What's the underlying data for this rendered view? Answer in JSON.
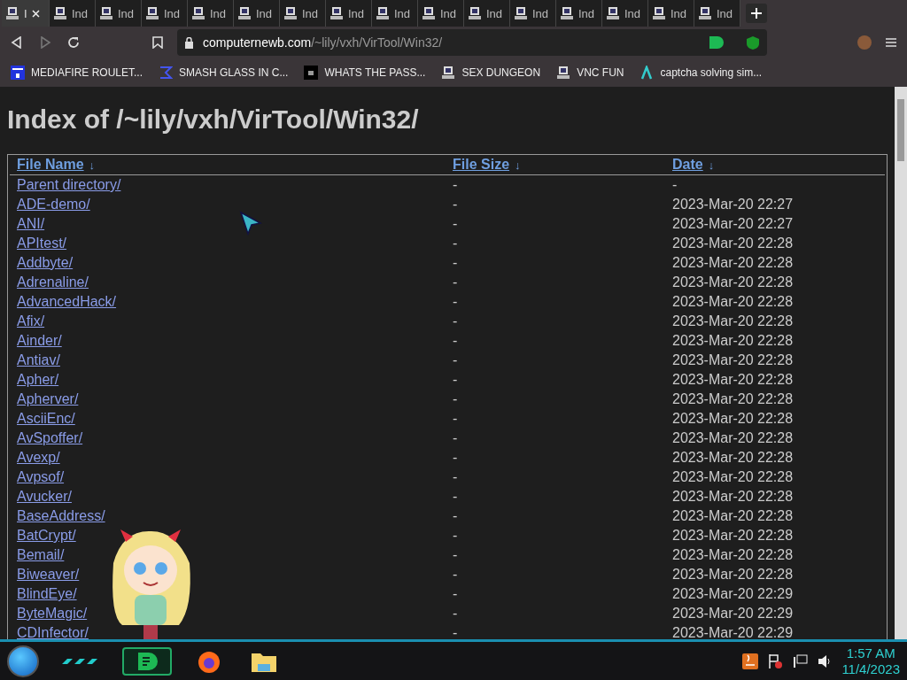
{
  "tabs": [
    {
      "label": "I",
      "selected": true
    },
    {
      "label": "Ind",
      "selected": false
    },
    {
      "label": "Ind",
      "selected": false
    },
    {
      "label": "Ind",
      "selected": false
    },
    {
      "label": "Ind",
      "selected": false
    },
    {
      "label": "Ind",
      "selected": false
    },
    {
      "label": "Ind",
      "selected": false
    },
    {
      "label": "Ind",
      "selected": false
    },
    {
      "label": "Ind",
      "selected": false
    },
    {
      "label": "Ind",
      "selected": false
    },
    {
      "label": "Ind",
      "selected": false
    },
    {
      "label": "Ind",
      "selected": false
    },
    {
      "label": "Ind",
      "selected": false
    },
    {
      "label": "Ind",
      "selected": false
    },
    {
      "label": "Ind",
      "selected": false
    },
    {
      "label": "Ind",
      "selected": false
    }
  ],
  "address": {
    "domain": "computernewb.com",
    "path": "/~lily/vxh/VirTool/Win32/"
  },
  "bookmarks": [
    {
      "label": "MEDIAFIRE ROULET...",
      "kind": "mf"
    },
    {
      "label": "SMASH GLASS IN C...",
      "kind": "sigma"
    },
    {
      "label": "WHATS THE PASS...",
      "kind": "dark"
    },
    {
      "label": "SEX DUNGEON",
      "kind": "computer"
    },
    {
      "label": "VNC FUN",
      "kind": "computer"
    },
    {
      "label": "captcha solving sim...",
      "kind": "lambda"
    }
  ],
  "page": {
    "title": "Index of /~lily/vxh/VirTool/Win32/",
    "columns": [
      {
        "label": "File Name",
        "sort": "↓"
      },
      {
        "label": "File Size",
        "sort": "↓"
      },
      {
        "label": "Date",
        "sort": "↓"
      }
    ],
    "rows": [
      {
        "name": "Parent directory/",
        "size": "-",
        "date": "-"
      },
      {
        "name": "ADE-demo/",
        "size": "-",
        "date": "2023-Mar-20 22:27"
      },
      {
        "name": "ANI/",
        "size": "-",
        "date": "2023-Mar-20 22:27"
      },
      {
        "name": "APItest/",
        "size": "-",
        "date": "2023-Mar-20 22:28"
      },
      {
        "name": "Addbyte/",
        "size": "-",
        "date": "2023-Mar-20 22:28"
      },
      {
        "name": "Adrenaline/",
        "size": "-",
        "date": "2023-Mar-20 22:28"
      },
      {
        "name": "AdvancedHack/",
        "size": "-",
        "date": "2023-Mar-20 22:28"
      },
      {
        "name": "Afix/",
        "size": "-",
        "date": "2023-Mar-20 22:28"
      },
      {
        "name": "Ainder/",
        "size": "-",
        "date": "2023-Mar-20 22:28"
      },
      {
        "name": "Antiav/",
        "size": "-",
        "date": "2023-Mar-20 22:28"
      },
      {
        "name": "Apher/",
        "size": "-",
        "date": "2023-Mar-20 22:28"
      },
      {
        "name": "Apherver/",
        "size": "-",
        "date": "2023-Mar-20 22:28"
      },
      {
        "name": "AsciiEnc/",
        "size": "-",
        "date": "2023-Mar-20 22:28"
      },
      {
        "name": "AvSpoffer/",
        "size": "-",
        "date": "2023-Mar-20 22:28"
      },
      {
        "name": "Avexp/",
        "size": "-",
        "date": "2023-Mar-20 22:28"
      },
      {
        "name": "Avpsof/",
        "size": "-",
        "date": "2023-Mar-20 22:28"
      },
      {
        "name": "Avucker/",
        "size": "-",
        "date": "2023-Mar-20 22:28"
      },
      {
        "name": "BaseAddress/",
        "size": "-",
        "date": "2023-Mar-20 22:28"
      },
      {
        "name": "BatCrypt/",
        "size": "-",
        "date": "2023-Mar-20 22:28"
      },
      {
        "name": "Bemail/",
        "size": "-",
        "date": "2023-Mar-20 22:28"
      },
      {
        "name": "Biweaver/",
        "size": "-",
        "date": "2023-Mar-20 22:28"
      },
      {
        "name": "BlindEye/",
        "size": "-",
        "date": "2023-Mar-20 22:29"
      },
      {
        "name": "ByteMagic/",
        "size": "-",
        "date": "2023-Mar-20 22:29"
      },
      {
        "name": "CDInfector/",
        "size": "-",
        "date": "2023-Mar-20 22:29"
      }
    ]
  },
  "taskbar": {
    "apps": [
      {
        "kind": "chat",
        "selected": true
      },
      {
        "kind": "firefox",
        "selected": false
      },
      {
        "kind": "folder",
        "selected": false
      }
    ],
    "time": "1:57 AM",
    "date": "11/4/2023"
  }
}
